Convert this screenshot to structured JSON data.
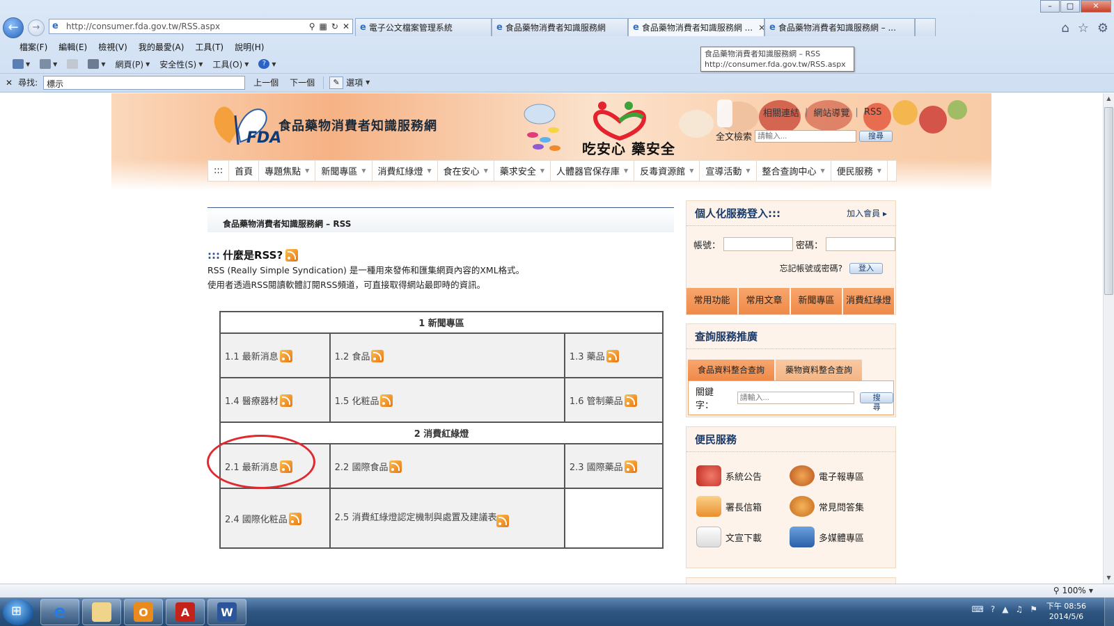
{
  "browser": {
    "address_url": "http://consumer.fda.gov.tw/RSS.aspx",
    "tabs": [
      {
        "label": "電子公文檔案管理系統"
      },
      {
        "label": "食品藥物消費者知識服務網"
      },
      {
        "label": "食品藥物消費者知識服務網 ..."
      },
      {
        "label": "食品藥物消費者知識服務網 – ..."
      }
    ],
    "tooltip_line1": "食品藥物消費者知識服務網 – RSS",
    "tooltip_line2": "http://consumer.fda.gov.tw/RSS.aspx",
    "menu": [
      "檔案(F)",
      "編輯(E)",
      "檢視(V)",
      "我的最愛(A)",
      "工具(T)",
      "說明(H)"
    ],
    "cmd": {
      "page": "網頁(P)",
      "safety": "安全性(S)",
      "tools": "工具(O)"
    },
    "find": {
      "label": "尋找:",
      "value": "標示",
      "prev": "上一個",
      "next": "下一個",
      "options": "選項"
    },
    "zoom": "100%"
  },
  "site": {
    "title": "食品藥物消費者知識服務網",
    "fda": "FDA",
    "slogan": "吃安心 藥安全",
    "toplinks": {
      "related": "相關連結",
      "sitemap": "網站導覽",
      "rss": "RSS"
    },
    "search": {
      "label": "全文檢索",
      "placeholder": "請輸入...",
      "button": "搜尋"
    },
    "nav": [
      {
        "label": "首頁",
        "dropdown": false
      },
      {
        "label": "專題焦點",
        "dropdown": true
      },
      {
        "label": "新聞專區",
        "dropdown": true
      },
      {
        "label": "消費紅綠燈",
        "dropdown": true
      },
      {
        "label": "食在安心",
        "dropdown": true
      },
      {
        "label": "藥求安全",
        "dropdown": true
      },
      {
        "label": "人體器官保存庫",
        "dropdown": true
      },
      {
        "label": "反毒資源館",
        "dropdown": true
      },
      {
        "label": "宣導活動",
        "dropdown": true
      },
      {
        "label": "整合查詢中心",
        "dropdown": true
      },
      {
        "label": "便民服務",
        "dropdown": true
      }
    ],
    "nav_prefix": ":::"
  },
  "main": {
    "breadcrumb": "食品藥物消費者知識服務網 – RSS",
    "rss_title": "什麼是RSS?",
    "rss_colons": ":::",
    "rss_desc1": "RSS (Really Simple Syndication) 是一種用來發佈和匯集網頁內容的XML格式。",
    "rss_desc2": "使用者透過RSS閱讀軟體訂閱RSS頻道，可直接取得網站最即時的資訊。",
    "sections": [
      {
        "header": "1 新聞專區",
        "rows": [
          [
            "1.1 最新消息",
            "1.2 食品",
            "1.3 藥品"
          ],
          [
            "1.4 醫療器材",
            "1.5 化粧品",
            "1.6 管制藥品"
          ]
        ]
      },
      {
        "header": "2 消費紅綠燈",
        "rows": [
          [
            "2.1 最新消息",
            "2.2 國際食品",
            "2.3 國際藥品"
          ],
          [
            "2.4 國際化粧品",
            "2.5 消費紅綠燈認定機制與處置及建議表",
            ""
          ]
        ]
      }
    ]
  },
  "sidebar": {
    "login": {
      "title": "個人化服務登入:::",
      "join": "加入會員",
      "account_label": "帳號：",
      "password_label": "密碼：",
      "forgot": "忘記帳號或密碼?",
      "login_button": "登入",
      "quick_tabs": [
        "常用功能",
        "常用文章",
        "新聞專區",
        "消費紅綠燈"
      ]
    },
    "query": {
      "title": "查詢服務推廣",
      "tabs": [
        "食品資料整合查詢",
        "藥物資料整合查詢"
      ],
      "keyword_label": "關鍵字：",
      "placeholder": "請輸入...",
      "button": "搜尋"
    },
    "services": {
      "title": "便民服務",
      "items": [
        {
          "label": "系統公告",
          "icon": "speaker"
        },
        {
          "label": "電子報專區",
          "icon": "news"
        },
        {
          "label": "署長信箱",
          "icon": "mail"
        },
        {
          "label": "常見問答集",
          "icon": "faq"
        },
        {
          "label": "文宣下載",
          "icon": "doc"
        },
        {
          "label": "多媒體專區",
          "icon": "tv"
        }
      ]
    }
  },
  "taskbar": {
    "time": "下午 08:56",
    "date": "2014/5/6"
  }
}
